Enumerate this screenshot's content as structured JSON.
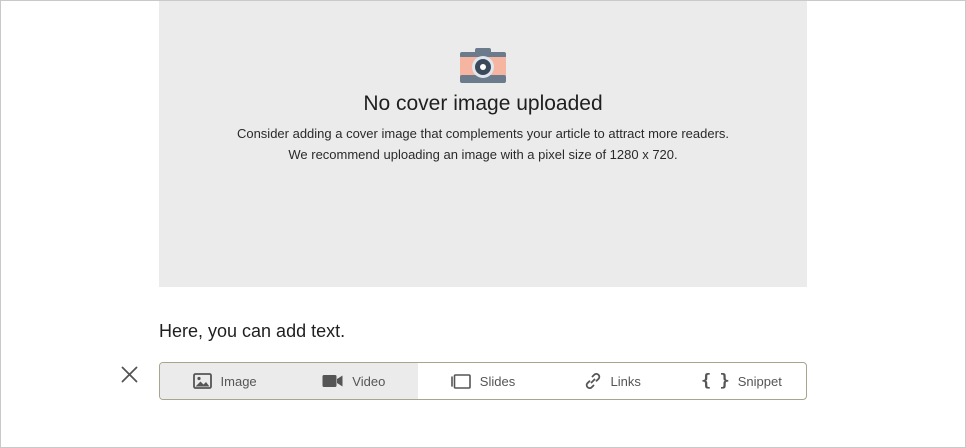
{
  "cover": {
    "icon": "camera-icon",
    "title": "No cover image uploaded",
    "line1": "Consider adding a cover image that complements your article to attract more readers.",
    "line2": "We recommend uploading an image with a pixel size of 1280 x 720."
  },
  "editor": {
    "text": "Here, you can add text."
  },
  "toolbar": {
    "close_icon": "close-icon",
    "items": [
      {
        "label": "Image",
        "icon": "image-icon"
      },
      {
        "label": "Video",
        "icon": "video-icon"
      },
      {
        "label": "Slides",
        "icon": "slides-icon"
      },
      {
        "label": "Links",
        "icon": "link-icon"
      },
      {
        "label": "Snippet",
        "icon": "braces-icon",
        "glyph": "{ }"
      }
    ]
  },
  "colors": {
    "cover_bg": "#ebebeb",
    "toolbar_border": "#a9a48c",
    "active_bg": "#ebebeb"
  }
}
